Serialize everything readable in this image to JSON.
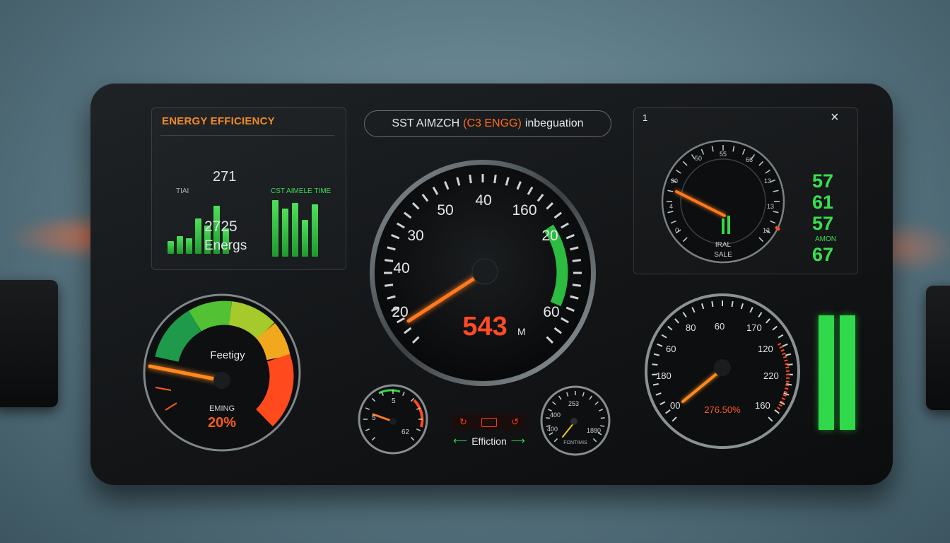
{
  "left_panel": {
    "title": "ENERGY EFFICIENCY",
    "value_top": "271",
    "label_small": "TIAI",
    "label_right": "CST AIMELE TIME",
    "value_main": "2725",
    "value_label": "Energs",
    "bars_left": [
      0.25,
      0.35,
      0.3,
      0.7,
      0.55,
      0.95,
      0.5
    ],
    "bars_right": [
      1.0,
      0.85,
      0.95,
      0.65,
      0.92
    ]
  },
  "search": {
    "prefix": "SST AIMZCH",
    "highlight": "(C3 ENGG)",
    "suffix": "inbeguation"
  },
  "main_gauge": {
    "ticks": [
      "20",
      "40",
      "30",
      "50",
      "40",
      "160",
      "20",
      "60"
    ],
    "readout": "543",
    "unit": "M",
    "accent_color": "#ff6a1e",
    "green_color": "#32d94a"
  },
  "efficiency_gauge": {
    "label": "Feetigy",
    "sublabel": "EMING",
    "value": "20%",
    "colors": [
      "#1f9a4b",
      "#52c234",
      "#a6c92c",
      "#f2a81d",
      "#ff4a1d"
    ]
  },
  "small_gauge_left": {
    "ticks": [
      "5",
      "5",
      "62"
    ]
  },
  "indicator": {
    "icons": [
      "circle-arrow-icon",
      "engine-icon",
      "circle-arrow-icon"
    ],
    "label": "Effiction"
  },
  "small_gauge_right": {
    "ticks": [
      "400",
      "253",
      "400",
      "1880"
    ],
    "label": "FONTIMIS"
  },
  "right_panel": {
    "number": "1",
    "close": "×",
    "gauge_ticks": [
      "50",
      "55",
      "66",
      "30",
      "13",
      "4",
      "13",
      "0",
      "13"
    ],
    "gauge_label1": "IRAL",
    "gauge_label2": "SALE",
    "readings": [
      "57",
      "61",
      "57",
      "67"
    ],
    "reading_label": "AMON"
  },
  "lower_right_gauge": {
    "ticks": [
      "60",
      "80",
      "170",
      "60",
      "120",
      "180",
      "220",
      "00",
      "160"
    ],
    "readout": "276.50%"
  }
}
